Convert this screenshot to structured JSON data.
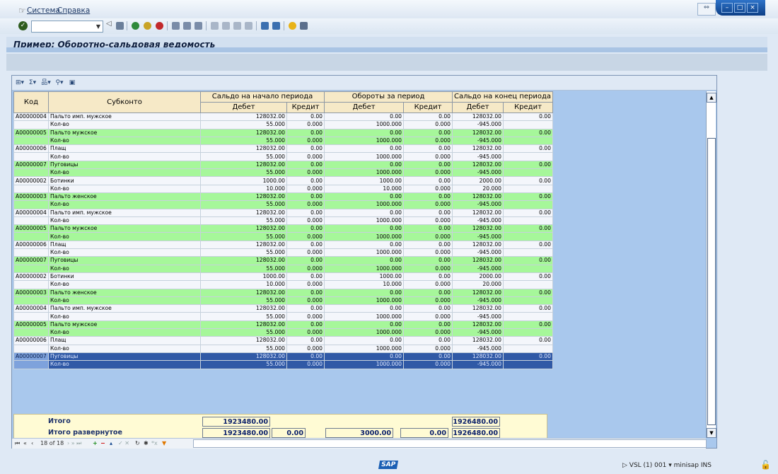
{
  "menu": {
    "items": [
      "Система",
      "Справка"
    ]
  },
  "toolbar": {
    "command_value": ""
  },
  "title": "Пример: Оборотно-сальдовая ведомость",
  "table": {
    "headers": {
      "code": "Код",
      "subconto": "Субконто",
      "group_start": "Сальдо на начало периода",
      "group_turnover": "Обороты за период",
      "group_end": "Сальдо на конец периода",
      "debit": "Дебет",
      "credit": "Кредит"
    },
    "rows": [
      {
        "code": "A00000004",
        "name": "Пальто имп. мужское",
        "kind": "w",
        "v": [
          "128032.00",
          "0.00",
          "0.00",
          "0.00",
          "128032.00",
          "0.00"
        ]
      },
      {
        "code": "",
        "name": "Кол-во",
        "kind": "w",
        "v": [
          "55.000",
          "0.000",
          "1000.000",
          "0.000",
          "-945.000",
          ""
        ]
      },
      {
        "code": "A00000005",
        "name": "Пальто мужское",
        "kind": "gr",
        "v": [
          "128032.00",
          "0.00",
          "0.00",
          "0.00",
          "128032.00",
          "0.00"
        ]
      },
      {
        "code": "",
        "name": "Кол-во",
        "kind": "gr",
        "v": [
          "55.000",
          "0.000",
          "1000.000",
          "0.000",
          "-945.000",
          ""
        ]
      },
      {
        "code": "A00000006",
        "name": "Плащ",
        "kind": "w",
        "v": [
          "128032.00",
          "0.00",
          "0.00",
          "0.00",
          "128032.00",
          "0.00"
        ]
      },
      {
        "code": "",
        "name": "Кол-во",
        "kind": "w",
        "v": [
          "55.000",
          "0.000",
          "1000.000",
          "0.000",
          "-945.000",
          ""
        ]
      },
      {
        "code": "A00000007",
        "name": "Пуговицы",
        "kind": "gr",
        "v": [
          "128032.00",
          "0.00",
          "0.00",
          "0.00",
          "128032.00",
          "0.00"
        ]
      },
      {
        "code": "",
        "name": "Кол-во",
        "kind": "gr",
        "v": [
          "55.000",
          "0.000",
          "1000.000",
          "0.000",
          "-945.000",
          ""
        ]
      },
      {
        "code": "A00000002",
        "name": "Ботинки",
        "kind": "w",
        "v": [
          "1000.00",
          "0.00",
          "1000.00",
          "0.00",
          "2000.00",
          "0.00"
        ]
      },
      {
        "code": "",
        "name": "Кол-во",
        "kind": "w",
        "v": [
          "10.000",
          "0.000",
          "10.000",
          "0.000",
          "20.000",
          ""
        ]
      },
      {
        "code": "A00000003",
        "name": "Пальто женское",
        "kind": "gr",
        "v": [
          "128032.00",
          "0.00",
          "0.00",
          "0.00",
          "128032.00",
          "0.00"
        ]
      },
      {
        "code": "",
        "name": "Кол-во",
        "kind": "gr",
        "v": [
          "55.000",
          "0.000",
          "1000.000",
          "0.000",
          "-945.000",
          ""
        ]
      },
      {
        "code": "A00000004",
        "name": "Пальто имп. мужское",
        "kind": "w",
        "v": [
          "128032.00",
          "0.00",
          "0.00",
          "0.00",
          "128032.00",
          "0.00"
        ]
      },
      {
        "code": "",
        "name": "Кол-во",
        "kind": "w",
        "v": [
          "55.000",
          "0.000",
          "1000.000",
          "0.000",
          "-945.000",
          ""
        ]
      },
      {
        "code": "A00000005",
        "name": "Пальто мужское",
        "kind": "gr",
        "v": [
          "128032.00",
          "0.00",
          "0.00",
          "0.00",
          "128032.00",
          "0.00"
        ]
      },
      {
        "code": "",
        "name": "Кол-во",
        "kind": "gr",
        "v": [
          "55.000",
          "0.000",
          "1000.000",
          "0.000",
          "-945.000",
          ""
        ]
      },
      {
        "code": "A00000006",
        "name": "Плащ",
        "kind": "w",
        "v": [
          "128032.00",
          "0.00",
          "0.00",
          "0.00",
          "128032.00",
          "0.00"
        ]
      },
      {
        "code": "",
        "name": "Кол-во",
        "kind": "w",
        "v": [
          "55.000",
          "0.000",
          "1000.000",
          "0.000",
          "-945.000",
          ""
        ]
      },
      {
        "code": "A00000007",
        "name": "Пуговицы",
        "kind": "gr",
        "v": [
          "128032.00",
          "0.00",
          "0.00",
          "0.00",
          "128032.00",
          "0.00"
        ]
      },
      {
        "code": "",
        "name": "Кол-во",
        "kind": "gr",
        "v": [
          "55.000",
          "0.000",
          "1000.000",
          "0.000",
          "-945.000",
          ""
        ]
      },
      {
        "code": "A00000002",
        "name": "Ботинки",
        "kind": "w",
        "v": [
          "1000.00",
          "0.00",
          "1000.00",
          "0.00",
          "2000.00",
          "0.00"
        ]
      },
      {
        "code": "",
        "name": "Кол-во",
        "kind": "w",
        "v": [
          "10.000",
          "0.000",
          "10.000",
          "0.000",
          "20.000",
          ""
        ]
      },
      {
        "code": "A00000003",
        "name": "Пальто женское",
        "kind": "gr",
        "v": [
          "128032.00",
          "0.00",
          "0.00",
          "0.00",
          "128032.00",
          "0.00"
        ]
      },
      {
        "code": "",
        "name": "Кол-во",
        "kind": "gr",
        "v": [
          "55.000",
          "0.000",
          "1000.000",
          "0.000",
          "-945.000",
          ""
        ]
      },
      {
        "code": "A00000004",
        "name": "Пальто имп. мужское",
        "kind": "w",
        "v": [
          "128032.00",
          "0.00",
          "0.00",
          "0.00",
          "128032.00",
          "0.00"
        ]
      },
      {
        "code": "",
        "name": "Кол-во",
        "kind": "w",
        "v": [
          "55.000",
          "0.000",
          "1000.000",
          "0.000",
          "-945.000",
          ""
        ]
      },
      {
        "code": "A00000005",
        "name": "Пальто мужское",
        "kind": "gr",
        "v": [
          "128032.00",
          "0.00",
          "0.00",
          "0.00",
          "128032.00",
          "0.00"
        ]
      },
      {
        "code": "",
        "name": "Кол-во",
        "kind": "gr",
        "v": [
          "55.000",
          "0.000",
          "1000.000",
          "0.000",
          "-945.000",
          ""
        ]
      },
      {
        "code": "A00000006",
        "name": "Плащ",
        "kind": "w",
        "v": [
          "128032.00",
          "0.00",
          "0.00",
          "0.00",
          "128032.00",
          "0.00"
        ]
      },
      {
        "code": "",
        "name": "Кол-во",
        "kind": "w",
        "v": [
          "55.000",
          "0.000",
          "1000.000",
          "0.000",
          "-945.000",
          ""
        ]
      },
      {
        "code": "A00000007",
        "name": "Пуговицы",
        "kind": "sel",
        "v": [
          "128032.00",
          "0.00",
          "0.00",
          "0.00",
          "128032.00",
          "0.00"
        ]
      },
      {
        "code": "",
        "name": "Кол-во",
        "kind": "sel",
        "v": [
          "55.000",
          "0.000",
          "1000.000",
          "0.000",
          "-945.000",
          ""
        ]
      }
    ],
    "totals": [
      {
        "label": "Итого",
        "v": [
          "1923480.00",
          "",
          "",
          "",
          "1926480.00"
        ]
      },
      {
        "label": "Итого развернутое",
        "v": [
          "1923480.00",
          "0.00",
          "3000.00",
          "0.00",
          "1926480.00"
        ]
      }
    ]
  },
  "pager": {
    "position": "18 of 18"
  },
  "status": {
    "system": "VSL (1) 001",
    "client": "minisap",
    "mode": "INS",
    "logo": "SAP"
  }
}
